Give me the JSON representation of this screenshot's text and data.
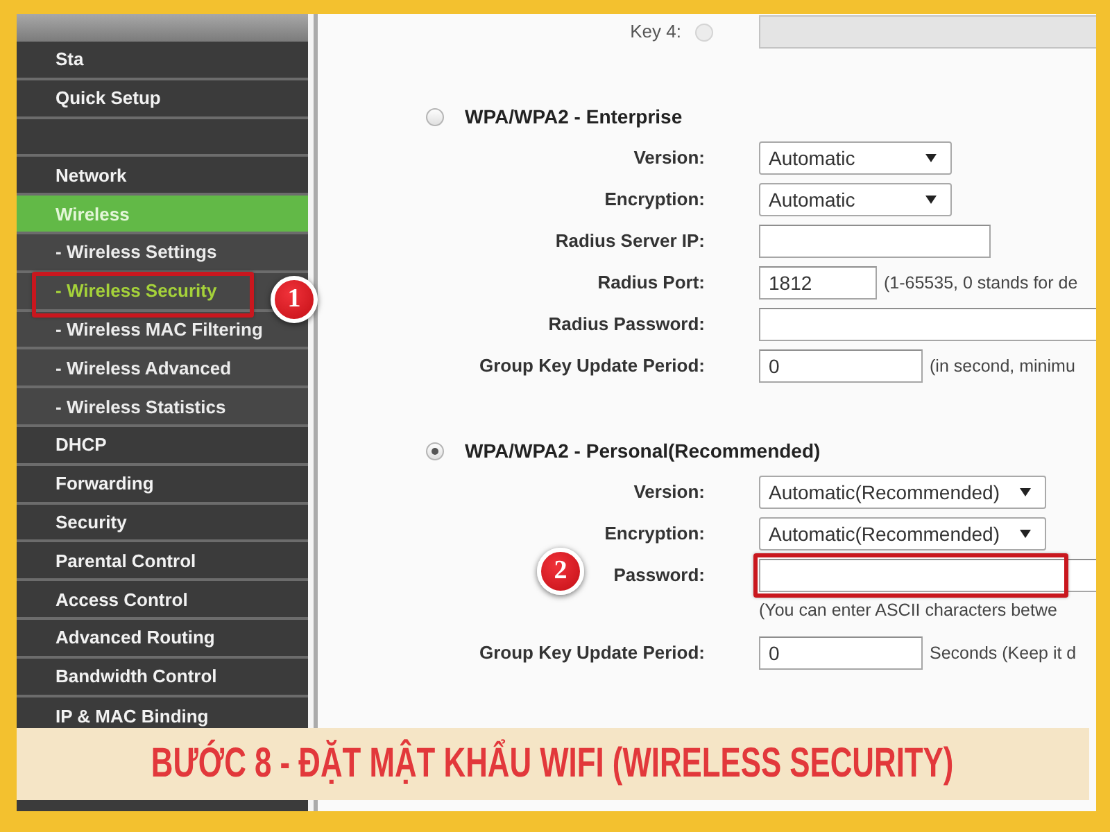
{
  "sidebar": {
    "items": [
      {
        "label": "Sta",
        "kind": "main",
        "selected": false,
        "highlighted": false
      },
      {
        "label": "Quick Setup",
        "kind": "main",
        "selected": false,
        "highlighted": false
      },
      {
        "kind": "blank"
      },
      {
        "label": "Network",
        "kind": "main",
        "selected": false,
        "highlighted": false
      },
      {
        "label": "Wireless",
        "kind": "main",
        "selected": true,
        "highlighted": false
      },
      {
        "label": "- Wireless Settings",
        "kind": "sub",
        "selected": false,
        "highlighted": false
      },
      {
        "label": "- Wireless Security",
        "kind": "sub",
        "selected": true,
        "highlighted": true,
        "callout": "1"
      },
      {
        "label": "- Wireless MAC Filtering",
        "kind": "sub",
        "selected": false,
        "highlighted": false
      },
      {
        "label": "- Wireless Advanced",
        "kind": "sub",
        "selected": false,
        "highlighted": false
      },
      {
        "label": "- Wireless Statistics",
        "kind": "sub",
        "selected": false,
        "highlighted": false
      },
      {
        "label": "DHCP",
        "kind": "main",
        "selected": false,
        "highlighted": false
      },
      {
        "label": "Forwarding",
        "kind": "main",
        "selected": false,
        "highlighted": false
      },
      {
        "label": "Security",
        "kind": "main",
        "selected": false,
        "highlighted": false
      },
      {
        "label": "Parental Control",
        "kind": "main",
        "selected": false,
        "highlighted": false
      },
      {
        "label": "Access Control",
        "kind": "main",
        "selected": false,
        "highlighted": false
      },
      {
        "label": "Advanced Routing",
        "kind": "main",
        "selected": false,
        "highlighted": false
      },
      {
        "label": "Bandwidth Control",
        "kind": "main",
        "selected": false,
        "highlighted": false
      },
      {
        "label": "IP & MAC Binding",
        "kind": "main",
        "selected": false,
        "highlighted": false
      }
    ]
  },
  "settings": {
    "key_row": {
      "label": "Key 4:",
      "selected": false,
      "disabled": true
    },
    "sections": [
      {
        "title": "WPA/WPA2 - Enterprise",
        "selected": false,
        "fields": [
          {
            "label": "Version:",
            "kind": "select",
            "value": "Automatic",
            "highlighted": false
          },
          {
            "label": "Encryption:",
            "kind": "select",
            "value": "Automatic",
            "highlighted": false
          },
          {
            "label": "Radius Server IP:",
            "kind": "text",
            "highlighted": false
          },
          {
            "label": "Radius Port:",
            "kind": "port",
            "value": "1812",
            "note": "(1-65535, 0 stands for de",
            "highlighted": false
          },
          {
            "label": "Radius Password:",
            "kind": "password",
            "highlighted": false
          },
          {
            "label": "Group Key Update Period:",
            "kind": "period",
            "value": "0",
            "note": "(in second, minimu",
            "highlighted": false
          }
        ]
      },
      {
        "title": "WPA/WPA2 - Personal(Recommended)",
        "selected": true,
        "fields": [
          {
            "label": "Version:",
            "kind": "select",
            "value": "Automatic(Recommended)",
            "highlighted": false
          },
          {
            "label": "Encryption:",
            "kind": "select",
            "value": "Automatic(Recommended)",
            "highlighted": false
          },
          {
            "label": "Password:",
            "kind": "password",
            "highlighted": true,
            "callout": "2",
            "help": "(You can enter ASCII characters betwe"
          },
          {
            "label": "Group Key Update Period:",
            "kind": "period",
            "value": "0",
            "note": "Seconds (Keep it d",
            "highlighted": false
          }
        ]
      }
    ]
  },
  "banner": {
    "text": "BƯỚC 8 - ĐẶT MẬT KHẨU WIFI (WIRELESS SECURITY)"
  }
}
